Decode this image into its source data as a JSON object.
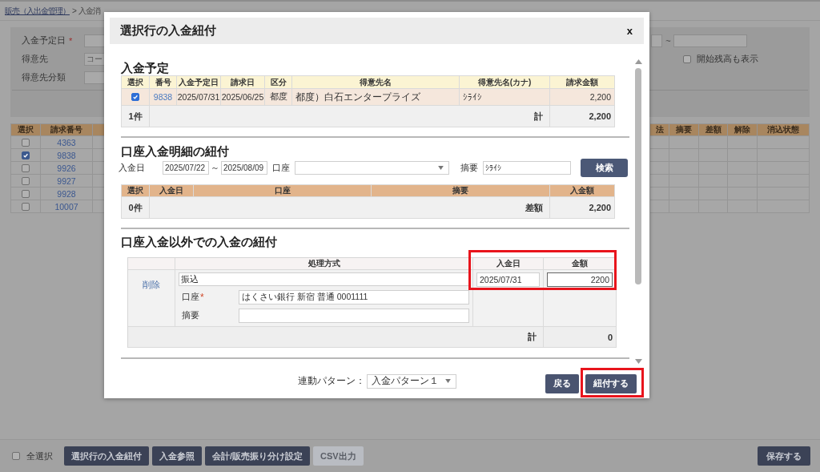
{
  "breadcrumb": {
    "link": "販売（入出金管理）",
    "separator": ">",
    "current": "入金消"
  },
  "filter_panel": {
    "fields": [
      {
        "label": "入金予定日",
        "required_mark": "*"
      },
      {
        "label": "得意先",
        "placeholder": "コー"
      },
      {
        "label": "得意先分類"
      }
    ],
    "range_separator": "~",
    "opening_balance": {
      "label": "開始残高も表示",
      "checked": false
    }
  },
  "invoice_table": {
    "left_columns": [
      "選択",
      "請求番号"
    ],
    "right_columns": [
      "法",
      "摘要",
      "差額",
      "解除",
      "消込状態"
    ],
    "rows": [
      {
        "checked": false,
        "number": "4363"
      },
      {
        "checked": true,
        "number": "9838"
      },
      {
        "checked": false,
        "number": "9926"
      },
      {
        "checked": false,
        "number": "9927"
      },
      {
        "checked": false,
        "number": "9928"
      },
      {
        "checked": false,
        "number": "10007"
      }
    ]
  },
  "dialog": {
    "title": "選択行の入金紐付",
    "close": "x",
    "scheduled": {
      "heading": "入金予定",
      "columns": [
        "選択",
        "番号",
        "入金予定日",
        "請求日",
        "区分",
        "得意先名",
        "得意先名(カナ)",
        "請求金額"
      ],
      "rows": [
        {
          "checked": true,
          "number": "9838",
          "scheduled_date": "2025/07/31",
          "invoice_date": "2025/06/25",
          "category": "都度",
          "customer": "都度）白石エンタープライズ",
          "customer_kana": "ｼﾗｲｼ",
          "amount": "2,200"
        }
      ],
      "footer": {
        "count": "1件",
        "total_label": "計",
        "total": "2,200"
      }
    },
    "bank": {
      "heading": "口座入金明細の紐付",
      "date_label": "入金日",
      "date_from": "2025/07/22",
      "range_separator": "～",
      "date_to": "2025/08/09",
      "account_label": "口座",
      "summary_label": "摘要",
      "summary": "ｼﾗｲｼ",
      "search_button": "検索",
      "columns": [
        "選択",
        "入金日",
        "口座",
        "摘要",
        "入金額"
      ],
      "footer": {
        "count": "0件",
        "difference_label": "差額",
        "difference": "2,200"
      }
    },
    "other": {
      "heading": "口座入金以外での入金の紐付",
      "highlighted": true,
      "columns": [
        "処理方式",
        "入金日",
        "金額"
      ],
      "rows": [
        {
          "delete_link": "削除",
          "method": "振込",
          "account_label": "口座",
          "account_required_mark": "*",
          "account": "はくさい銀行 新宿 普通 0001111",
          "summary_label": "摘要",
          "date": "2025/07/31",
          "amount": "2200",
          "amount_focused": true
        }
      ],
      "footer": {
        "total_label": "計",
        "total": "0"
      }
    },
    "pattern": {
      "label": "連動パターン：",
      "value": "入金パターン１"
    },
    "buttons": [
      {
        "label": "戻る",
        "highlighted": false
      },
      {
        "label": "紐付する",
        "highlighted": true
      }
    ]
  },
  "action_bar": {
    "select_all": {
      "label": "全選択",
      "checked": false
    },
    "buttons": [
      {
        "label": "選択行の入金紐付",
        "disabled": false
      },
      {
        "label": "入金参照",
        "disabled": false
      },
      {
        "label": "会計/販売振り分け設定",
        "disabled": false
      },
      {
        "label": "CSV出力",
        "disabled": true
      }
    ],
    "save_button": "保存する"
  }
}
